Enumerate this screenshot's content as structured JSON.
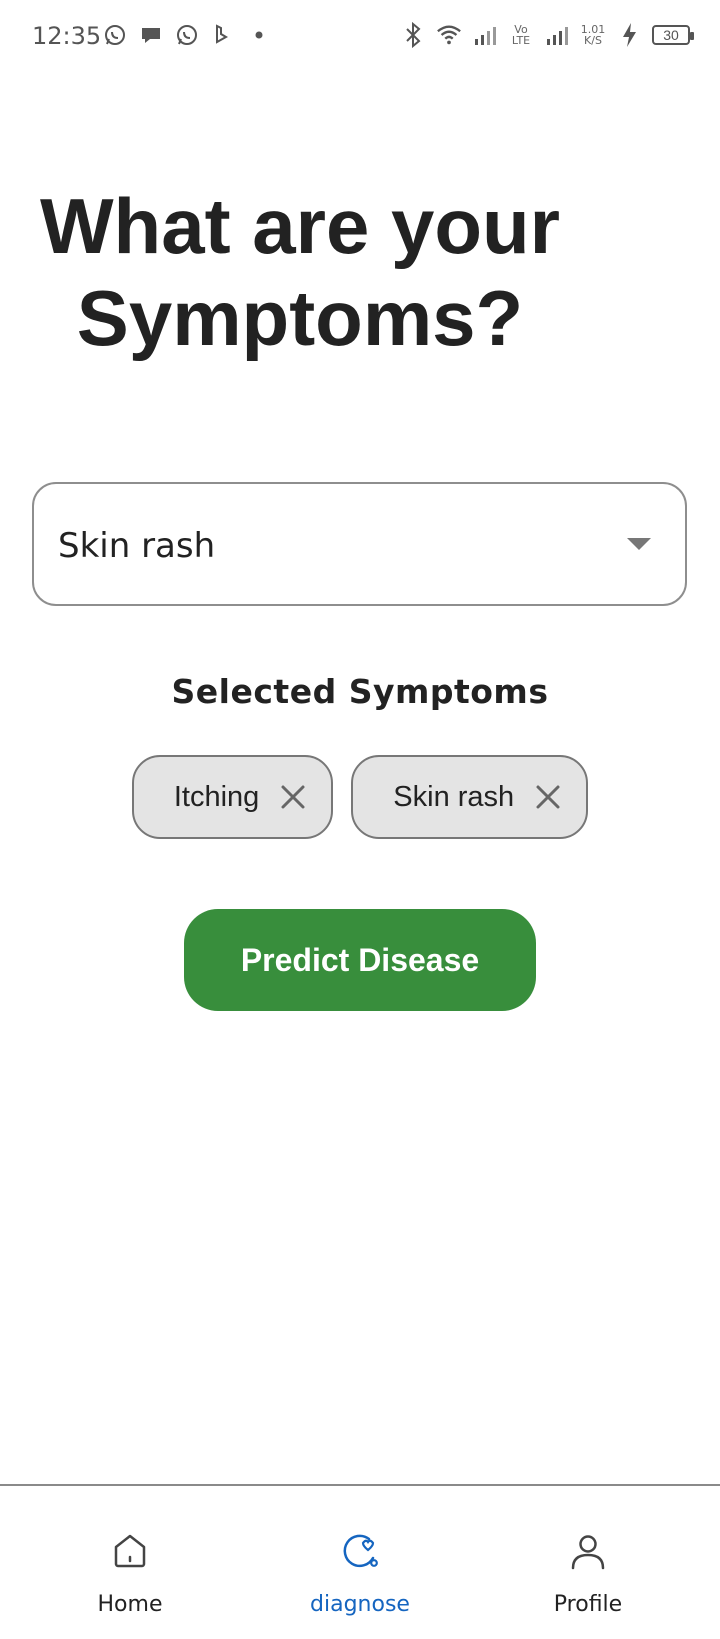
{
  "status_bar": {
    "time": "12:35",
    "network_speed_value": "1.01",
    "network_speed_unit": "K/S",
    "volte_top": "Vo",
    "volte_bottom": "LTE",
    "battery": "30"
  },
  "page": {
    "title": "What are your Symptoms?"
  },
  "dropdown": {
    "selected_value": "Skin rash"
  },
  "selected": {
    "heading": "Selected Symptoms",
    "chips": [
      "Itching",
      "Skin rash"
    ]
  },
  "actions": {
    "predict_label": "Predict Disease"
  },
  "bottom_nav": {
    "items": [
      {
        "label": "Home",
        "icon": "home-icon",
        "active": false
      },
      {
        "label": "diagnose",
        "icon": "diagnose-icon",
        "active": true
      },
      {
        "label": "Profile",
        "icon": "person-icon",
        "active": false
      }
    ]
  },
  "colors": {
    "accent": "#388e3c",
    "nav_active": "#1565c0",
    "chip_bg": "#e4e4e4"
  }
}
